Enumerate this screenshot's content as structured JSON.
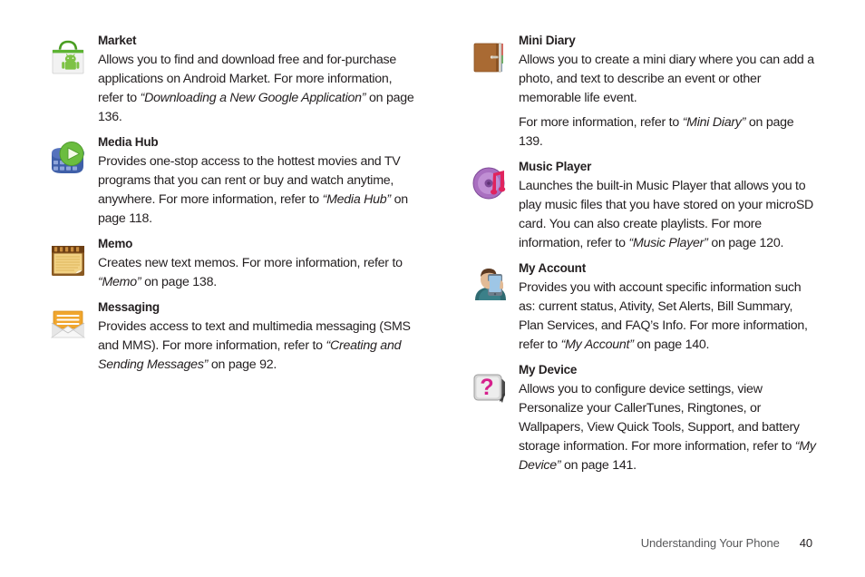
{
  "document": {
    "type": "user-manual-page",
    "background": "#ffffff",
    "text_color": "#231f20"
  },
  "columns": {
    "left": [
      {
        "icon": "android-market-bag-icon",
        "title": "Market",
        "paragraphs": [
          [
            {
              "t": "Allows you to find and download free and for-purchase applications on Android Market. For more information, refer to ",
              "i": false
            },
            {
              "t": "“Downloading a New Google Application”",
              "i": true
            },
            {
              "t": "  on page 136.",
              "i": false
            }
          ]
        ]
      },
      {
        "icon": "media-hub-filmstrip-play-icon",
        "title": "Media Hub",
        "paragraphs": [
          [
            {
              "t": "Provides one-stop access to the hottest movies and TV programs that you can rent or buy and watch anytime, anywhere. For more information, refer to ",
              "i": false
            },
            {
              "t": "“Media Hub”",
              "i": true
            },
            {
              "t": " on page 118.",
              "i": false
            }
          ]
        ]
      },
      {
        "icon": "memo-notepad-icon",
        "title": "Memo",
        "paragraphs": [
          [
            {
              "t": "Creates new text memos. For more information, refer to ",
              "i": false
            },
            {
              "t": "“Memo”",
              "i": true
            },
            {
              "t": "  on page 138.",
              "i": false
            }
          ]
        ]
      },
      {
        "icon": "messaging-envelope-icon",
        "title": "Messaging",
        "paragraphs": [
          [
            {
              "t": "Provides access to text and multimedia messaging (SMS and MMS). For more information, refer to ",
              "i": false
            },
            {
              "t": "“Creating and Sending Messages”",
              "i": true
            },
            {
              "t": "  on page 92.",
              "i": false
            }
          ]
        ]
      }
    ],
    "right": [
      {
        "icon": "mini-diary-book-icon",
        "title": "Mini Diary",
        "paragraphs": [
          [
            {
              "t": "Allows you to create a mini diary where you can add a photo, and text to describe an event or other memorable life event.",
              "i": false
            }
          ],
          [
            {
              "t": "For more information, refer to ",
              "i": false
            },
            {
              "t": "“Mini Diary”",
              "i": true
            },
            {
              "t": " on page 139.",
              "i": false
            }
          ]
        ]
      },
      {
        "icon": "music-player-cd-note-icon",
        "title": "Music Player",
        "paragraphs": [
          [
            {
              "t": "Launches the built-in Music Player that allows you to play music files that you have stored on your microSD card. You can also create playlists. For more information, refer to ",
              "i": false
            },
            {
              "t": "“Music Player”",
              "i": true
            },
            {
              "t": "  on page 120.",
              "i": false
            }
          ]
        ]
      },
      {
        "icon": "my-account-person-phone-icon",
        "title": "My Account",
        "paragraphs": [
          [
            {
              "t": "Provides you with account specific information such as: current status, Ativity, Set Alerts, Bill Summary, Plan Services, and FAQ’s Info. For more information, refer to ",
              "i": false
            },
            {
              "t": "“My Account”",
              "i": true
            },
            {
              "t": "  on page 140.",
              "i": false
            }
          ]
        ]
      },
      {
        "icon": "my-device-question-mark-icon",
        "title": "My Device",
        "paragraphs": [
          [
            {
              "t": "Allows you to configure device settings, view Personalize your CallerTunes, Ringtones, or Wallpapers, View Quick Tools, Support, and battery storage information. For more information, refer to ",
              "i": false
            },
            {
              "t": "“My Device”",
              "i": true
            },
            {
              "t": " on page 141.",
              "i": false
            }
          ]
        ]
      }
    ]
  },
  "footer": {
    "chapter": "Understanding Your Phone",
    "page_number": "40"
  }
}
